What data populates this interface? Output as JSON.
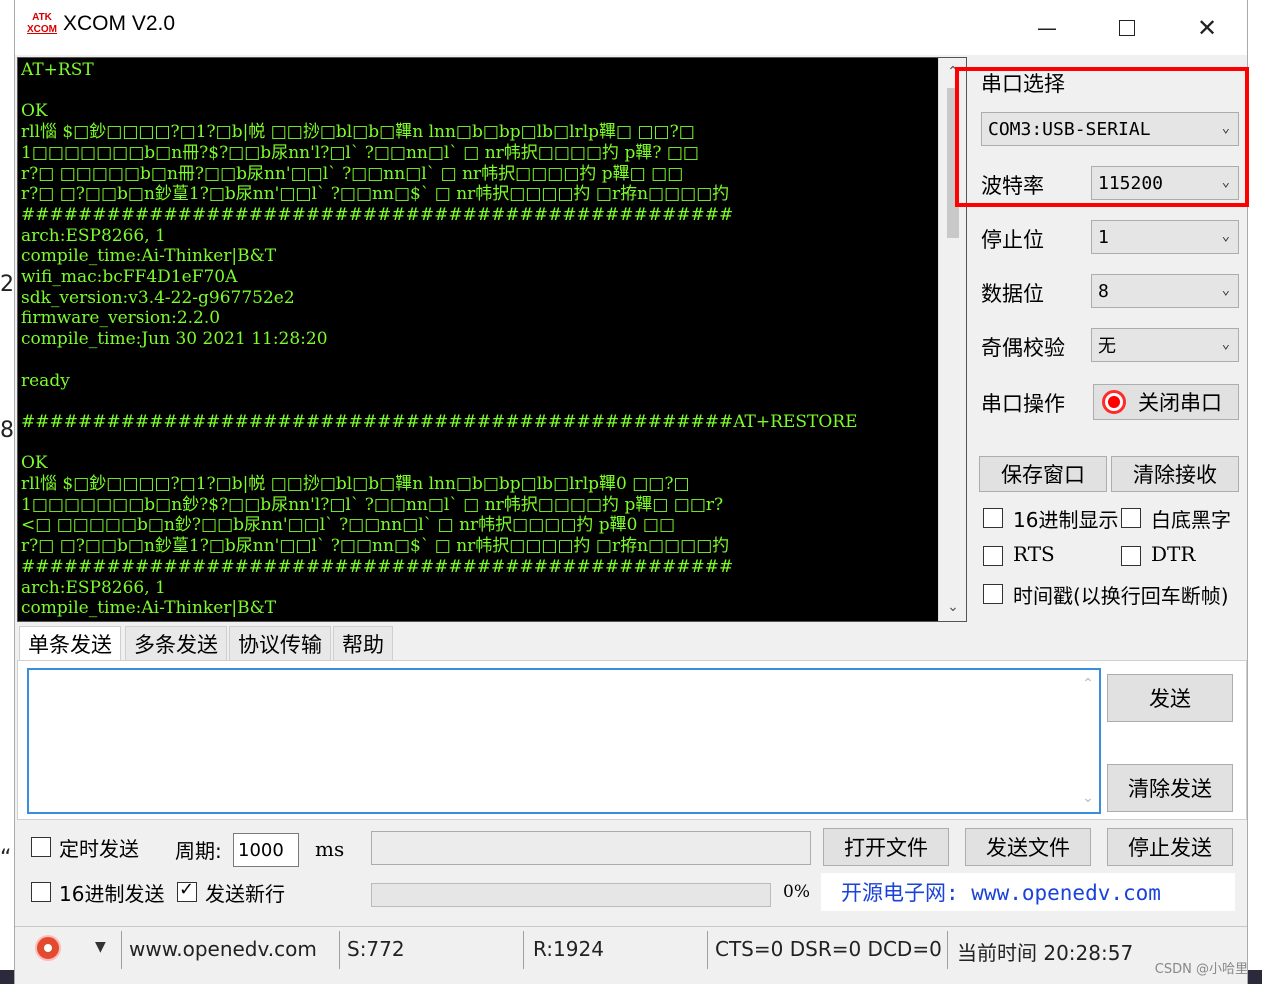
{
  "window": {
    "title": "XCOM V2.0",
    "logo_top": "ATK",
    "logo_bottom": "XCOM"
  },
  "receive_lines": [
    "AT+RST",
    "",
    "OK",
    "rll惱 $□鈔□□□□?□1?□b|帨 □□挱□bl□b□鞸n lnn□b□bp□lb□lrlp鞸□ □□?□",
    "1□□□□□□□b□n冊?$?□□b尿nn'l?□l` ?□□nn□l` □ nr帏択□□□□扚 p鞸? □□",
    "r?□ □□□□□b□n冊?□□b尿nn'□□l` ?□□nn□l` □ nr帏択□□□□扚 p鞸□ □□",
    "r?□ □?□□b□n鈔葟1?□b尿nn'□□l` ?□□nn□$` □ nr帏択□□□□扚 □r拵n□□□□扚",
    "##################################################",
    "arch:ESP8266, 1",
    "compile_time:Ai-Thinker|B&T",
    "wifi_mac:bcFF4D1eF70A",
    "sdk_version:v3.4-22-g967752e2",
    "firmware_version:2.2.0",
    "compile_time:Jun 30 2021 11:28:20",
    "",
    "ready",
    "",
    "##################################################AT+RESTORE",
    "",
    "OK",
    "rll惱 $□鈔□□□□?□1?□b|帨 □□挱□bl□b□鞸n lnn□b□bp□lb□lrlp鞸0 □□?□",
    "1□□□□□□□b□n鈔?$?□□b尿nn'l?□l` ?□□nn□l` □ nr帏択□□□□扚 p鞸□ □□r?",
    "<□ □□□□□b□n鈔?□□b尿nn'□□l` ?□□nn□l` □ nr帏択□□□□扚 p鞸0 □□",
    "r?□ □?□□b□n鈔葟1?□b尿nn'□□l` ?□□nn□$` □ nr帏択□□□□扚 □r拵n□□□□扚",
    "##################################################",
    "arch:ESP8266, 1",
    "compile_time:Ai-Thinker|B&T"
  ],
  "settings": {
    "port_label": "串口选择",
    "port_value": "COM3:USB-SERIAL",
    "baud_label": "波特率",
    "baud_value": "115200",
    "stop_label": "停止位",
    "stop_value": "1",
    "data_label": "数据位",
    "data_value": "8",
    "parity_label": "奇偶校验",
    "parity_value": "无",
    "op_label": "串口操作",
    "op_button": "关闭串口"
  },
  "receive_controls": {
    "save_window": "保存窗口",
    "clear_receive": "清除接收",
    "hex_display": "16进制显示",
    "white_bg": "白底黑字",
    "rts": "RTS",
    "dtr": "DTR",
    "timestamp": "时间戳(以换行回车断帧)"
  },
  "tabs": [
    "单条发送",
    "多条发送",
    "协议传输",
    "帮助"
  ],
  "send": {
    "send_button": "发送",
    "clear_send": "清除发送",
    "timed_send": "定时发送",
    "period_label": "周期:",
    "period_value": "1000",
    "period_unit": "ms",
    "open_file": "打开文件",
    "send_file": "发送文件",
    "stop_send": "停止发送",
    "hex_send": "16进制发送",
    "send_newline": "发送新行",
    "progress_text": "0%",
    "progress": 0,
    "promo": "开源电子网: www.openedv.com"
  },
  "status": {
    "url": "www.openedv.com",
    "sent": "S:772",
    "received": "R:1924",
    "lines": "CTS=0 DSR=0 DCD=0",
    "time": "当前时间 20:28:57"
  },
  "watermark": "CSDN @小哈里",
  "edge_chars": [
    "2",
    "8",
    "“"
  ],
  "colors": {
    "terminal_bg": "#000000",
    "terminal_fg": "#7cfc2a",
    "highlight": "#ff0000",
    "focus": "#3b8de0",
    "promo": "#1a43d9"
  }
}
